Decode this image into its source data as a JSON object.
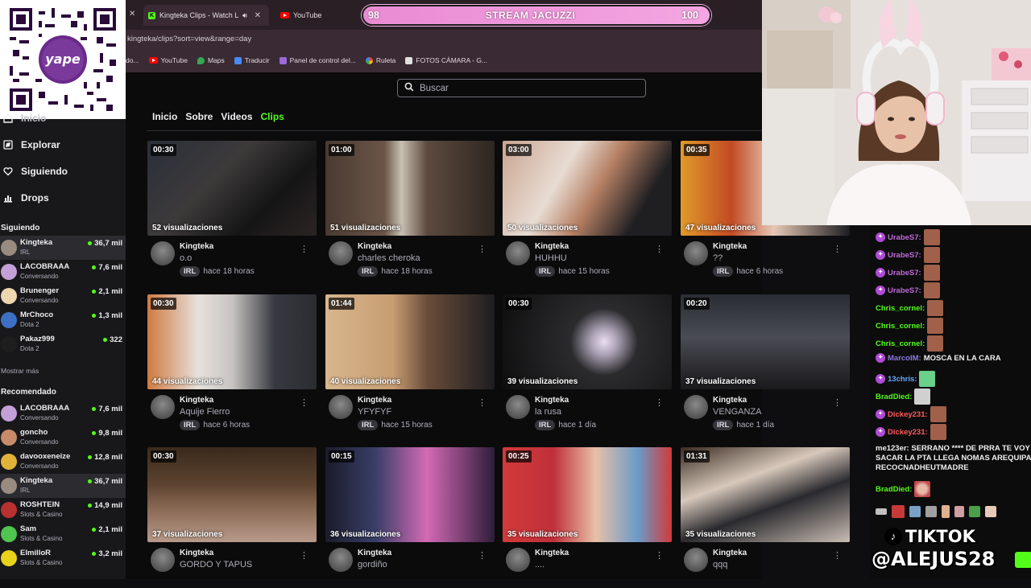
{
  "browser": {
    "tabs": [
      {
        "label": "Kingteka Clips - Watch Live",
        "active": true
      },
      {
        "label": "YouTube",
        "active": false
      }
    ],
    "url": "kingteka/clips?sort=view&range=day",
    "bookmarks": [
      "YouTube",
      "Maps",
      "Traducir",
      "Panel de control del...",
      "Ruleta",
      "FOTOS CÁMARA - G..."
    ],
    "bookmark_prefix": "do..."
  },
  "jacuzzi": {
    "left": "98",
    "title": "STREAM JACUZZI",
    "right": "100"
  },
  "qr": {
    "brand": "yape"
  },
  "sidebar": {
    "nav": [
      {
        "label": "Inicio",
        "icon": "home-icon"
      },
      {
        "label": "Explorar",
        "icon": "compass-icon"
      },
      {
        "label": "Siguiendo",
        "icon": "heart-icon"
      },
      {
        "label": "Drops",
        "icon": "drops-icon"
      }
    ],
    "following_title": "Siguiendo",
    "following": [
      {
        "name": "Kingteka",
        "category": "IRL",
        "viewers": "36,7 mil",
        "color": "#9a8b80"
      },
      {
        "name": "LACOBRAAA",
        "category": "Conversando",
        "viewers": "7,6 mil",
        "color": "#c3a0d8"
      },
      {
        "name": "Brunenger",
        "category": "Conversando",
        "viewers": "2,1 mil",
        "color": "#f0d6b0"
      },
      {
        "name": "MrChoco",
        "category": "Dota 2",
        "viewers": "1,3 mil",
        "color": "#3d6fc4"
      },
      {
        "name": "Pakaz999",
        "category": "Dota 2",
        "viewers": "322",
        "color": "#1e1e1e"
      }
    ],
    "show_more": "Mostrar más",
    "recommended_title": "Recomendado",
    "recommended": [
      {
        "name": "LACOBRAAA",
        "category": "Conversando",
        "viewers": "7,6 mil",
        "color": "#c3a0d8"
      },
      {
        "name": "goncho",
        "category": "Conversando",
        "viewers": "9,8 mil",
        "color": "#c78b6a"
      },
      {
        "name": "davooxeneize",
        "category": "Conversando",
        "viewers": "12,8 mil",
        "color": "#e0b23a"
      },
      {
        "name": "Kingteka",
        "category": "IRL",
        "viewers": "36,7 mil",
        "color": "#9a8b80"
      },
      {
        "name": "ROSHTEIN",
        "category": "Slots & Casino",
        "viewers": "14,9 mil",
        "color": "#b83030"
      },
      {
        "name": "Sam",
        "category": "Slots & Casino",
        "viewers": "2,1 mil",
        "color": "#4fc44f"
      },
      {
        "name": "ElmilloR",
        "category": "Slots & Casino",
        "viewers": "3,2 mil",
        "color": "#e8d21a"
      }
    ]
  },
  "main": {
    "search_placeholder": "Buscar",
    "tabs": [
      "Inicio",
      "Sobre",
      "Videos",
      "Clips"
    ],
    "active_tab": "Clips",
    "clips": [
      {
        "duration": "00:30",
        "views": "52 visualizaciones",
        "author": "Kingteka",
        "title": "o.o",
        "tag": "IRL",
        "time": "hace 18 horas",
        "bg": "linear-gradient(135deg,#2a2f3a 0%,#3d3a3a 40%,#151516 70%,#2c2424 100%)"
      },
      {
        "duration": "01:00",
        "views": "51 visualizaciones",
        "author": "Kingteka",
        "title": "charles cheroka",
        "tag": "IRL",
        "time": "hace 18 horas",
        "bg": "linear-gradient(90deg,#4a3a30 0%,#6b5548 35%,#c8c0b2 45%,#5d4a3e 60%,#2d2620 100%)"
      },
      {
        "duration": "03:00",
        "views": "50 visualizaciones",
        "author": "Kingteka",
        "title": "HUHHU",
        "tag": "IRL",
        "time": "hace 15 horas",
        "bg": "linear-gradient(120deg,#c9a48f 0%,#e8dcd3 35%,#b57f63 55%,#1f1f22 80%)"
      },
      {
        "duration": "00:35",
        "views": "47 visualizaciones",
        "author": "Kingteka",
        "title": "??",
        "tag": "IRL",
        "time": "hace 6 horas",
        "bg": "linear-gradient(90deg,#e09a2a 0%,#c24a24 30%,#e6c8b5 55%,#1c1c20 100%)"
      },
      {
        "duration": "00:30",
        "views": "44 visualizaciones",
        "author": "Kingteka",
        "title": "Aquije Fierro",
        "tag": "IRL",
        "time": "hace 6 horas",
        "bg": "linear-gradient(90deg,#d07a40 0%,#e6e1dc 30%,#c8c4c2 50%,#373a40 75%,#2a2c31 100%)"
      },
      {
        "duration": "01:44",
        "views": "40 visualizaciones",
        "author": "Kingteka",
        "title": "YFYFYF",
        "tag": "IRL",
        "time": "hace 15 horas",
        "bg": "linear-gradient(90deg,#d8b68d 0%,#c79d72 40%,#6a4d3a 60%,#1d1d20 100%)"
      },
      {
        "duration": "00:30",
        "views": "39 visualizaciones",
        "author": "Kingteka",
        "title": "la rusa",
        "tag": "IRL",
        "time": "hace 1 día",
        "bg": "radial-gradient(circle at 60% 50%,#e9dff0 0%,#a9a0b3 12%,#2b2b2d 30%,#0e0e0f 100%)"
      },
      {
        "duration": "00:20",
        "views": "37 visualizaciones",
        "author": "Kingteka",
        "title": "VENGANZA",
        "tag": "IRL",
        "time": "hace 1 día",
        "bg": "linear-gradient(180deg,#2a2c33 0%,#4a4c55 45%,#2f2f33 75%,#1a1a1d 100%)"
      },
      {
        "duration": "00:30",
        "views": "37 visualizaciones",
        "author": "Kingteka",
        "title": "GORDO Y TAPUS",
        "tag": "IRL",
        "time": "",
        "bg": "linear-gradient(180deg,#3a2a1c 0%,#5e4430 40%,#8a6a55 65%,#b89a8a 100%)"
      },
      {
        "duration": "00:15",
        "views": "36 visualizaciones",
        "author": "Kingteka",
        "title": "gordiño",
        "tag": "IRL",
        "time": "",
        "bg": "linear-gradient(90deg,#1b1b2a 0%,#3a3f6a 30%,#d46ab5 60%,#2d1d3a 100%)"
      },
      {
        "duration": "00:25",
        "views": "35 visualizaciones",
        "author": "Kingteka",
        "title": "....",
        "tag": "IRL",
        "time": "",
        "bg": "linear-gradient(90deg,#d23a3a 0%,#c0303a 30%,#e8c0a8 55%,#6a9ac8 80%,#d23a3a 100%)"
      },
      {
        "duration": "01:31",
        "views": "35 visualizaciones",
        "author": "Kingteka",
        "title": "qqq",
        "tag": "IRL",
        "time": "",
        "bg": "linear-gradient(160deg,#3a2a20 0%,#d7c8bb 35%,#2a2a2e 60%,#c9bdb3 100%)"
      }
    ]
  },
  "chat": {
    "lines": [
      {
        "user": "UrabeS7:",
        "color": "#c06ad8",
        "badge": true,
        "msg": "",
        "emote": "#a0604a"
      },
      {
        "user": "UrabeS7:",
        "color": "#c06ad8",
        "badge": true,
        "msg": "",
        "emote": "#a0604a"
      },
      {
        "user": "UrabeS7:",
        "color": "#c06ad8",
        "badge": true,
        "msg": "",
        "emote": "#a0604a"
      },
      {
        "user": "UrabeS7:",
        "color": "#c06ad8",
        "badge": true,
        "msg": "",
        "emote": "#a0604a"
      },
      {
        "user": "Chris_cornel:",
        "color": "#53fc18",
        "badge": false,
        "msg": "",
        "emote": "#a0604a"
      },
      {
        "user": "Chris_cornel:",
        "color": "#53fc18",
        "badge": false,
        "msg": "",
        "emote": "#a0604a"
      },
      {
        "user": "Chris_cornel:",
        "color": "#53fc18",
        "badge": false,
        "msg": "",
        "emote": "#a0604a"
      },
      {
        "user": "MarcoIM:",
        "color": "#8a7adf",
        "badge": true,
        "msg": "MOSCA EN LA CARA",
        "emote": ""
      },
      {
        "user": "13chris:",
        "color": "#6aa8ff",
        "badge": true,
        "msg": "",
        "emote": "#6ad08a"
      },
      {
        "user": "BradDied:",
        "color": "#53fc18",
        "badge": false,
        "msg": "",
        "emote": "#d0d0d0"
      },
      {
        "user": "Dickey231:",
        "color": "#ff5a5a",
        "badge": true,
        "msg": "",
        "emote": "#a0604a"
      },
      {
        "user": "Dickey231:",
        "color": "#ff5a5a",
        "badge": true,
        "msg": "",
        "emote": "#a0604a"
      }
    ],
    "long_user": "me123er:",
    "long_msg_1": "SERRANO **** DE PRRA TE VOY",
    "long_msg_2": "SACAR LA PTA LLEGA NOMAS AREQUIPA",
    "long_msg_3": "RECOCNADHEUTMADRE",
    "last_user": "BradDied:"
  },
  "overlay": {
    "tiktok_label": "TIKTOK",
    "handle": "@ALEJUS28"
  }
}
